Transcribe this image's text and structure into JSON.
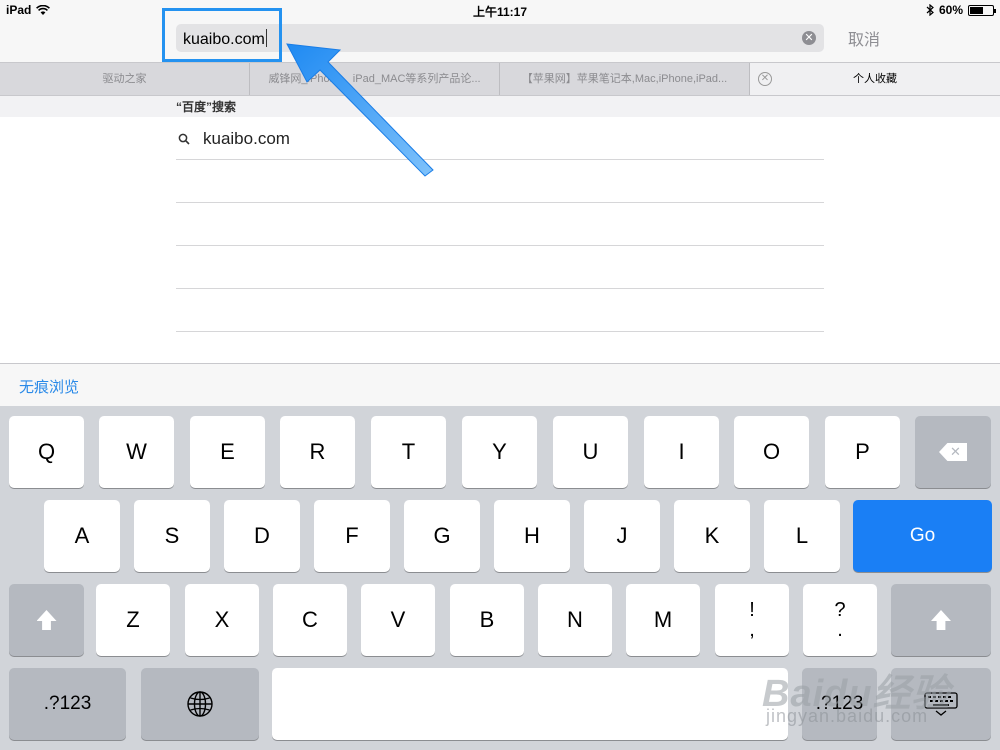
{
  "status_bar": {
    "device": "iPad",
    "time": "上午11:17",
    "battery": "60%",
    "battery_level": 0.6
  },
  "address_bar": {
    "url_value": "kuaibo.com",
    "clear_icon": "clear-icon",
    "cancel_label": "取消"
  },
  "tabs": [
    {
      "label": "驱动之家"
    },
    {
      "label": "威锋网_iPhone、iPad_MAC等系列产品论..."
    },
    {
      "label": "【苹果网】苹果笔记本,Mac,iPhone,iPad..."
    }
  ],
  "active_tab": {
    "label": "个人收藏",
    "close_icon": "close-icon"
  },
  "suggestions": {
    "header": "“百度”搜索",
    "items": [
      {
        "text": "kuaibo.com",
        "icon": "search-icon"
      }
    ]
  },
  "private_browsing": {
    "label": "无痕浏览"
  },
  "keyboard": {
    "row1": [
      "Q",
      "W",
      "E",
      "R",
      "T",
      "Y",
      "U",
      "I",
      "O",
      "P"
    ],
    "row2": [
      "A",
      "S",
      "D",
      "F",
      "G",
      "H",
      "J",
      "K",
      "L"
    ],
    "go_label": "Go",
    "row3": [
      "Z",
      "X",
      "C",
      "V",
      "B",
      "N",
      "M"
    ],
    "punct1_top": "!",
    "punct1_bottom": ",",
    "punct2_top": "?",
    "punct2_bottom": ".",
    "numbers_label": ".?123",
    "numbers_label_right": ".?123"
  },
  "watermark": {
    "brand": "Baidu经验",
    "url": "jingyan.baidu.com"
  },
  "colors": {
    "accent": "#1a7ff5",
    "highlight_box": "#2492f0",
    "link": "#2a8ae8",
    "keyboard_bg": "#d1d4d9"
  }
}
